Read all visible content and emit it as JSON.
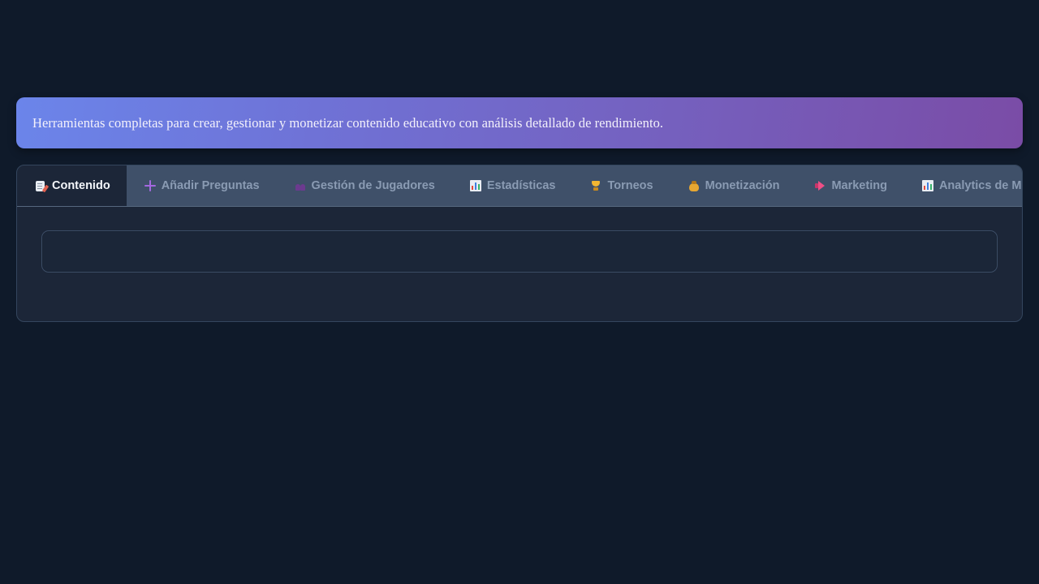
{
  "banner": {
    "description": "Herramientas completas para crear, gestionar y monetizar contenido educativo con análisis detallado de rendimiento."
  },
  "tabs": [
    {
      "label": "Contenido",
      "icon": "memo-icon",
      "active": true
    },
    {
      "label": "Añadir Preguntas",
      "icon": "plus-icon",
      "active": false
    },
    {
      "label": "Gestión de Jugadores",
      "icon": "people-icon",
      "active": false
    },
    {
      "label": "Estadísticas",
      "icon": "bar-chart-icon",
      "active": false
    },
    {
      "label": "Torneos",
      "icon": "trophy-icon",
      "active": false
    },
    {
      "label": "Monetización",
      "icon": "money-bag-icon",
      "active": false
    },
    {
      "label": "Marketing",
      "icon": "megaphone-icon",
      "active": false
    },
    {
      "label": "Analytics de Mercado",
      "icon": "bar-chart-icon",
      "active": false
    }
  ],
  "colors": {
    "page_background": "#0f1a2a",
    "panel_background": "#1c2638",
    "tabbar_background": "#3f5069",
    "banner_gradient_start": "#6b85ea",
    "banner_gradient_end": "#7a4ca6",
    "tab_inactive_text": "#8a9bb3",
    "tab_active_text": "#f4f6fa"
  }
}
